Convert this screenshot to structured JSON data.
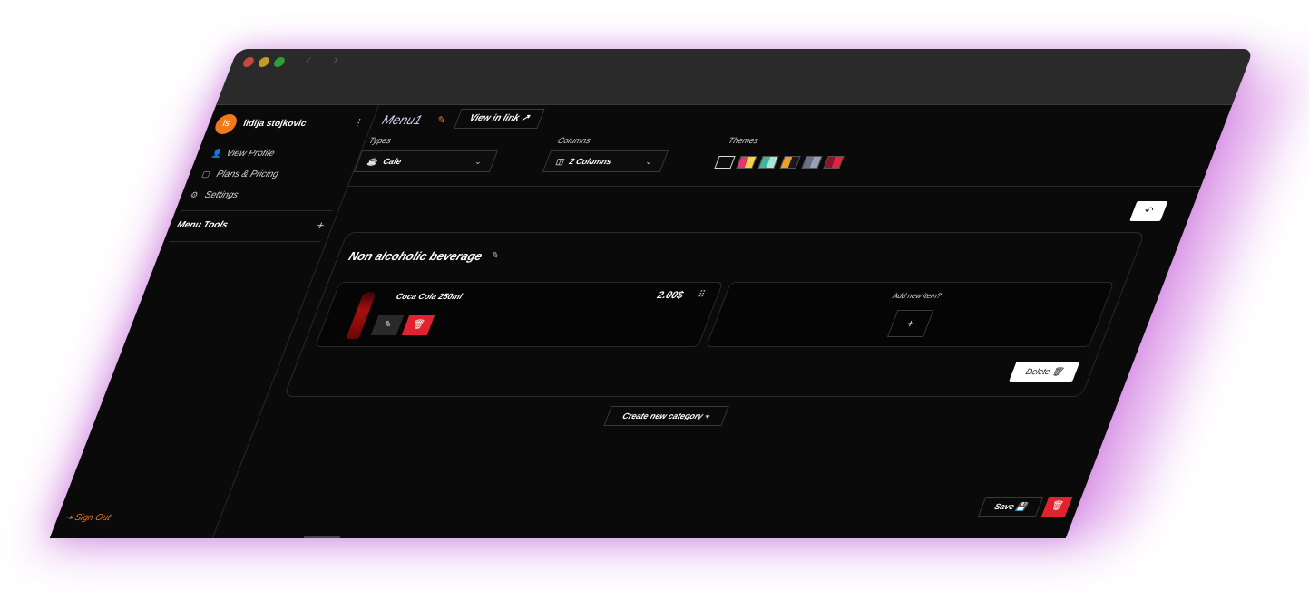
{
  "user": {
    "initials": "ls",
    "name": "lidija stojkovic"
  },
  "sidebar": {
    "links": [
      {
        "label": "View Profile",
        "icon": "user-icon"
      },
      {
        "label": "Plans & Pricing",
        "icon": "box-icon"
      },
      {
        "label": "Settings",
        "icon": "gear-icon"
      }
    ],
    "menu_tools_label": "Menu Tools",
    "sign_out_label": "Sign Out"
  },
  "topbar": {
    "menu_name": "Menu1",
    "view_link_label": "View in link",
    "types_label": "Types",
    "types_value": "Cafe",
    "columns_label": "Columns",
    "columns_value": "2 Columns",
    "themes_label": "Themes",
    "theme_swatches": [
      [
        "#0d0d0d",
        "#0d0d0d"
      ],
      [
        "#e9336a",
        "#f5d34b"
      ],
      [
        "#3fb5a0",
        "#a8e6d6"
      ],
      [
        "#f0a020",
        "#1a1a1a"
      ],
      [
        "#6a6f8a",
        "#9aa0b8"
      ],
      [
        "#8a1430",
        "#e0233f"
      ]
    ]
  },
  "category": {
    "title": "Non alcoholic beverage",
    "items": [
      {
        "name": "Coca Cola 250ml",
        "price": "2.00$"
      }
    ],
    "add_item_label": "Add new item?",
    "delete_label": "Delete"
  },
  "actions": {
    "create_category_label": "Create new category",
    "save_label": "Save"
  },
  "colors": {
    "accent": "#f07a1a",
    "danger": "#e0232f",
    "glow": "#cf6fe0"
  }
}
